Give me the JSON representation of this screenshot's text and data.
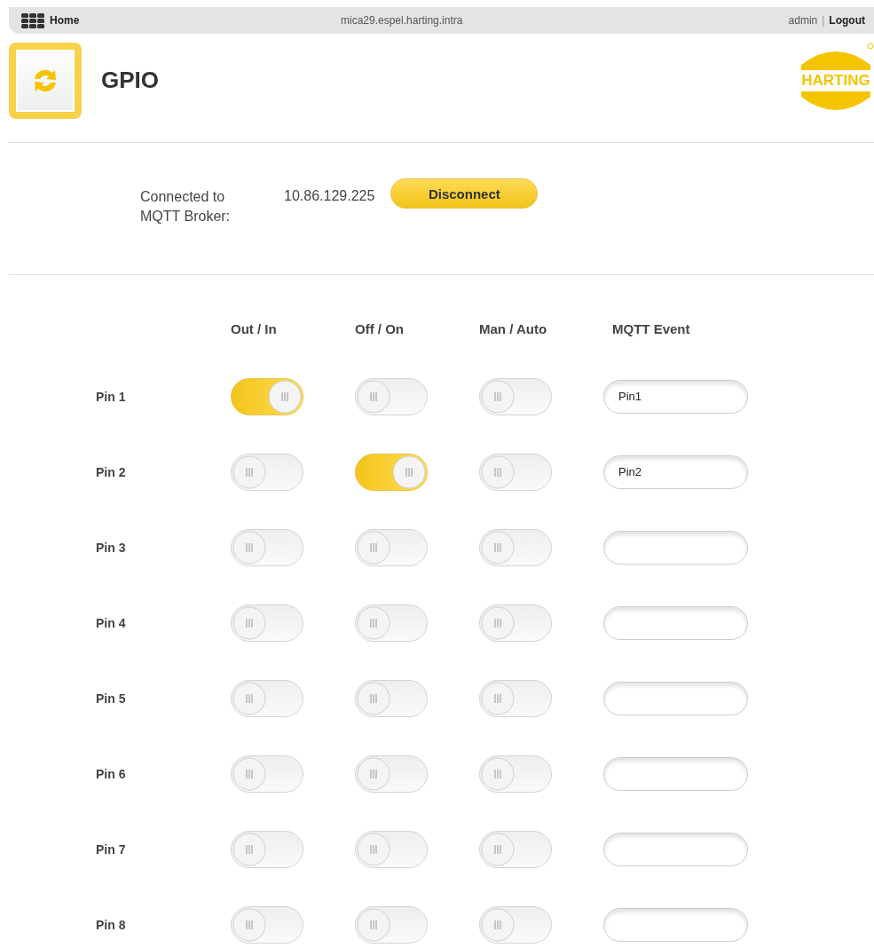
{
  "top_bar": {
    "home": "Home",
    "host": "mica29.espel.harting.intra",
    "user": "admin",
    "separator": "|",
    "logout": "Logout"
  },
  "header": {
    "title": "GPIO",
    "logo_text": "HARTING"
  },
  "connection": {
    "label_line1": "Connected to",
    "label_line2": "MQTT Broker:",
    "address": "10.86.129.225",
    "button": "Disconnect"
  },
  "columns": [
    "Out / In",
    "Off / On",
    "Man / Auto",
    "MQTT Event"
  ],
  "pins": [
    {
      "label": "Pin 1",
      "out_in": true,
      "off_on": false,
      "man_auto": false,
      "event": "Pin1"
    },
    {
      "label": "Pin 2",
      "out_in": false,
      "off_on": true,
      "man_auto": false,
      "event": "Pin2"
    },
    {
      "label": "Pin 3",
      "out_in": false,
      "off_on": false,
      "man_auto": false
    },
    {
      "label": "Pin 4",
      "out_in": false,
      "off_on": false,
      "man_auto": false
    },
    {
      "label": "Pin 5",
      "out_in": false,
      "off_on": false,
      "man_auto": false
    },
    {
      "label": "Pin 6",
      "out_in": false,
      "off_on": false,
      "man_auto": false
    },
    {
      "label": "Pin 7",
      "out_in": false,
      "off_on": false,
      "man_auto": false
    },
    {
      "label": "Pin 8",
      "out_in": false,
      "off_on": false,
      "man_auto": false
    }
  ]
}
